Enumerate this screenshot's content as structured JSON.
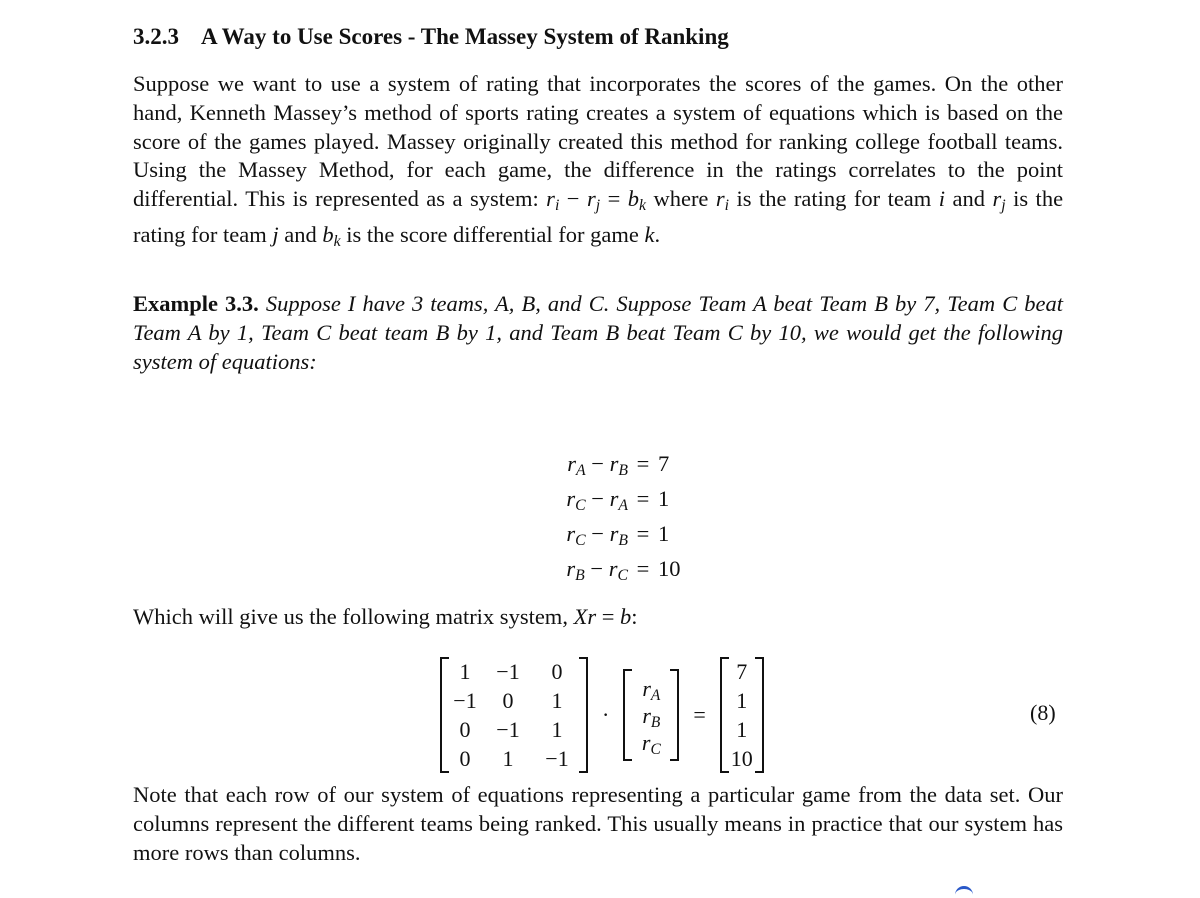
{
  "section": {
    "number": "3.2.3",
    "title": "A Way to Use Scores - The Massey System of Ranking"
  },
  "paragraph1": {
    "text": "Suppose we want to use a system of rating that incorporates the scores of the games. On the other hand, Kenneth Massey’s method of sports rating creates a system of equations which is based on the score of the games played. Massey originally created this method for ranking college football teams. Using the Massey Method, for each game, the difference in the ratings correlates to the point differential. This is represented as a system: ",
    "where": "where",
    "is_rating_for_team": "is the rating for team",
    "and": "and",
    "is_score_diff": "is the score differential for game"
  },
  "example": {
    "label": "Example 3.3.",
    "text": "Suppose I have 3 teams, A, B, and C. Suppose Team A beat Team B by 7, Team C beat Team A by 1, Team C beat team B by 1, and Team B beat Team C by 10, we would get the following system of equations:"
  },
  "equations": [
    {
      "lhs_a": "A",
      "lhs_b": "B",
      "rhs": "7"
    },
    {
      "lhs_a": "C",
      "lhs_b": "A",
      "rhs": "1"
    },
    {
      "lhs_a": "C",
      "lhs_b": "B",
      "rhs": "1"
    },
    {
      "lhs_a": "B",
      "lhs_b": "C",
      "rhs": "10"
    }
  ],
  "matrix_intro": "Which will give us the following matrix system,",
  "matrix_system": {
    "X": [
      [
        "1",
        "−1",
        "0"
      ],
      [
        "−1",
        "0",
        "1"
      ],
      [
        "0",
        "−1",
        "1"
      ],
      [
        "0",
        "1",
        "−1"
      ]
    ],
    "r": [
      "A",
      "B",
      "C"
    ],
    "b": [
      "7",
      "1",
      "1",
      "10"
    ],
    "equation_number": "(8)"
  },
  "paragraph_note": "Note that each row of our system of equations representing a particular game from the data set. Our columns represent the different teams being ranked. This usually means in practice that our system has more rows than columns."
}
